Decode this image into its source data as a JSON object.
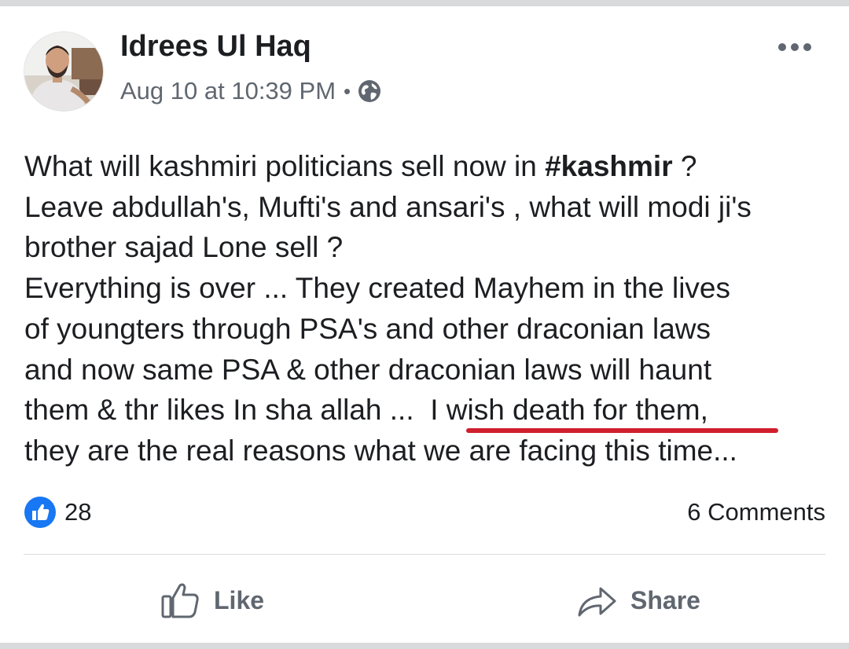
{
  "post": {
    "author": "Idrees Ul Haq",
    "timestamp": "Aug 10 at 10:39 PM",
    "separator": "•",
    "privacy_icon": "globe-icon",
    "more_icon": "more-options-icon",
    "text": {
      "line1_pre": "What will kashmiri politicians sell now in ",
      "hashtag": "#kashmir",
      "line1_post": " ?",
      "line2": "Leave abdullah's, Mufti's and ansari's , what will modi ji's",
      "line3": "brother sajad Lone sell ?",
      "line4": "Everything is over ... They created Mayhem in the lives",
      "line5": "of youngters through PSA's and other draconian laws",
      "line6": "and now same PSA & other draconian laws will haunt",
      "line7_pre": "them & thr likes In sha allah ...  ",
      "line7_highlight": "I wish death for them,",
      "line8": "they are the real reasons what we are facing this time..."
    },
    "highlight_color": "#cf1f2e"
  },
  "stats": {
    "like_count": "28",
    "comments": "6 Comments"
  },
  "actions": {
    "like_label": "Like",
    "share_label": "Share"
  },
  "colors": {
    "text": "#1c1e21",
    "secondary": "#606770",
    "like_blue": "#1877f2",
    "background": "#d9dadc"
  }
}
